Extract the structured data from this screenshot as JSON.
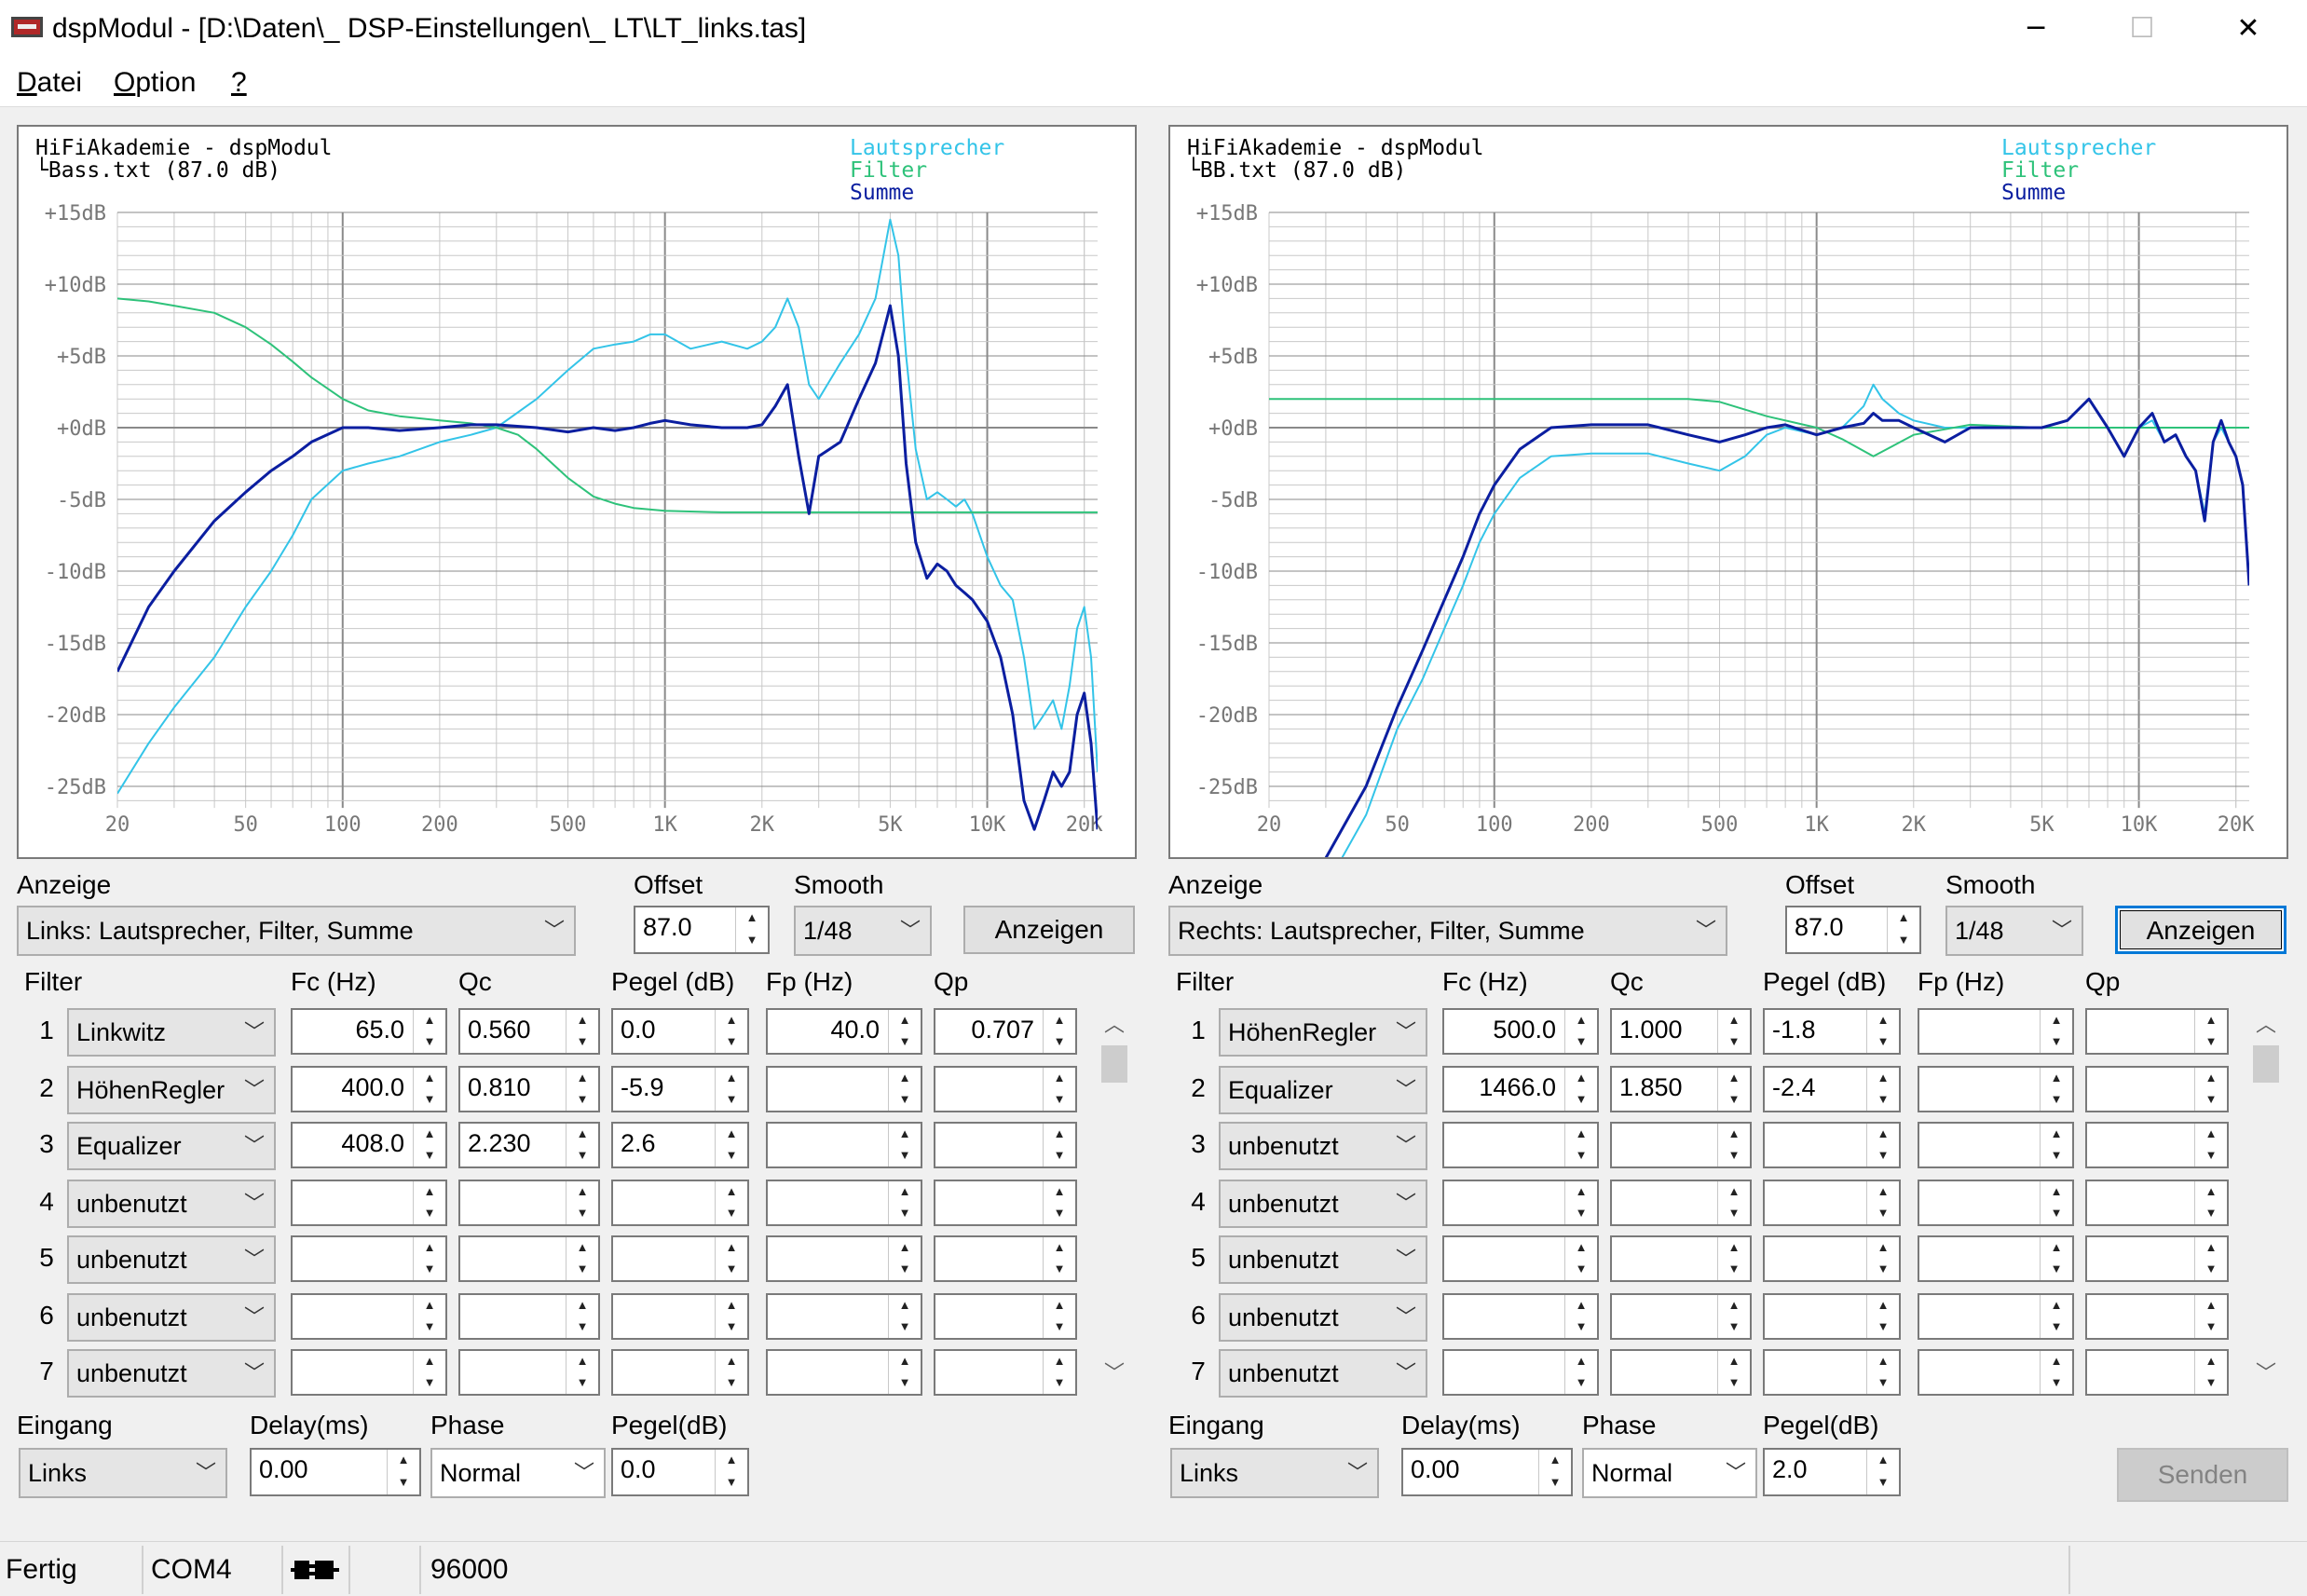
{
  "window": {
    "title": "dspModul - [D:\\Daten\\_ DSP-Einstellungen\\_  LT\\LT_links.tas]",
    "minimize": "─",
    "maximize": "☐",
    "close": "✕"
  },
  "menu": [
    {
      "accel": "D",
      "rest": "atei"
    },
    {
      "accel": "O",
      "rest": "ption"
    },
    {
      "accel": "?",
      "rest": ""
    }
  ],
  "colors": {
    "lautsprecher": "#33c4e8",
    "filter": "#2ec27a",
    "summe": "#0b1ea0",
    "grid": "#c8c8c8",
    "grid_major": "#8a8a8a"
  },
  "panels": [
    {
      "plot": {
        "header1": "HiFiAkademie - dspModul",
        "header2": "└Bass.txt  (87.0 dB)",
        "legend": [
          "Lautsprecher",
          "Filter",
          "Summe"
        ],
        "chart_data": {
          "type": "line",
          "x_scale": "log",
          "xlim": [
            20,
            22000
          ],
          "ylim": [
            -25,
            15
          ],
          "yticks": [
            "+15dB",
            "+10dB",
            "+5dB",
            "+0dB",
            "-5dB",
            "-10dB",
            "-15dB",
            "-20dB",
            "-25dB"
          ],
          "xticks": [
            "20",
            "50",
            "100",
            "200",
            "500",
            "1K",
            "2K",
            "5K",
            "10K",
            "20K"
          ],
          "series": [
            {
              "name": "Lautsprecher",
              "x": [
                20,
                25,
                30,
                40,
                50,
                60,
                70,
                80,
                100,
                120,
                150,
                200,
                250,
                300,
                400,
                500,
                600,
                700,
                800,
                900,
                1000,
                1200,
                1500,
                1800,
                2000,
                2200,
                2400,
                2600,
                2800,
                3000,
                3500,
                4000,
                4500,
                5000,
                5300,
                5600,
                6000,
                6500,
                7000,
                7500,
                8000,
                8500,
                9000,
                10000,
                11000,
                12000,
                13000,
                14000,
                15000,
                16000,
                17000,
                18000,
                19000,
                20000,
                21000,
                22000
              ],
              "y": [
                -25.5,
                -22,
                -19.5,
                -16,
                -12.5,
                -10,
                -7.5,
                -5,
                -3,
                -2.5,
                -2,
                -1,
                -0.5,
                0,
                2,
                4,
                5.5,
                5.8,
                6,
                6.5,
                6.5,
                5.5,
                6,
                5.5,
                6,
                7,
                9,
                7,
                3,
                2,
                4.5,
                6.5,
                9,
                14.5,
                12,
                5,
                -1.5,
                -5,
                -4.5,
                -5,
                -5.5,
                -5,
                -6,
                -9,
                -11,
                -12,
                -16,
                -21,
                -20,
                -19,
                -21,
                -18,
                -14,
                -12.5,
                -16,
                -24
              ]
            },
            {
              "name": "Filter",
              "x": [
                20,
                25,
                30,
                40,
                50,
                60,
                70,
                80,
                100,
                120,
                150,
                200,
                250,
                300,
                350,
                400,
                500,
                600,
                700,
                800,
                1000,
                1500,
                2000,
                5000,
                10000,
                22000
              ],
              "y": [
                9,
                8.8,
                8.5,
                8,
                7,
                5.8,
                4.6,
                3.5,
                2,
                1.2,
                0.8,
                0.5,
                0.3,
                0,
                -0.5,
                -1.5,
                -3.5,
                -4.8,
                -5.3,
                -5.6,
                -5.8,
                -5.9,
                -5.9,
                -5.9,
                -5.9,
                -5.9
              ]
            },
            {
              "name": "Summe",
              "x": [
                20,
                25,
                30,
                40,
                50,
                60,
                70,
                80,
                100,
                120,
                150,
                200,
                250,
                300,
                400,
                500,
                600,
                700,
                800,
                900,
                1000,
                1200,
                1500,
                1800,
                2000,
                2200,
                2400,
                2600,
                2800,
                3000,
                3500,
                4000,
                4500,
                5000,
                5300,
                5600,
                6000,
                6500,
                7000,
                7500,
                8000,
                8500,
                9000,
                10000,
                11000,
                12000,
                13000,
                14000,
                15000,
                16000,
                17000,
                18000,
                19000,
                20000,
                21000,
                22000
              ],
              "y": [
                -17,
                -12.5,
                -10,
                -6.5,
                -4.5,
                -3,
                -2,
                -1,
                0,
                0,
                -0.2,
                0,
                0.2,
                0.2,
                0,
                -0.3,
                0,
                -0.2,
                0,
                0.3,
                0.5,
                0.2,
                0,
                0,
                0.2,
                1.5,
                3,
                -2,
                -6,
                -2,
                -1,
                2,
                4.5,
                8.5,
                5,
                -2.5,
                -8,
                -10.5,
                -9.5,
                -10,
                -11,
                -11.5,
                -12,
                -13.5,
                -16,
                -20,
                -26,
                -28,
                -26,
                -24,
                -25,
                -24,
                -20,
                -18.5,
                -22,
                -28
              ]
            }
          ]
        }
      },
      "anzeige_label": "Anzeige",
      "anzeige_value": "Links: Lautsprecher, Filter, Summe",
      "offset_label": "Offset",
      "offset_value": "87.0",
      "smooth_label": "Smooth",
      "smooth_value": "1/48",
      "anzeigen_button": "Anzeigen",
      "headers": [
        "Filter",
        "Fc (Hz)",
        "Qc",
        "Pegel (dB)",
        "Fp (Hz)",
        "Qp"
      ],
      "filters": [
        {
          "n": "1",
          "type": "Linkwitz",
          "fc": "65.0",
          "qc": "0.560",
          "pegel": "0.0",
          "fp": "40.0",
          "qp": "0.707"
        },
        {
          "n": "2",
          "type": "HöhenRegler",
          "fc": "400.0",
          "qc": "0.810",
          "pegel": "-5.9",
          "fp": "",
          "qp": ""
        },
        {
          "n": "3",
          "type": "Equalizer",
          "fc": "408.0",
          "qc": "2.230",
          "pegel": "2.6",
          "fp": "",
          "qp": ""
        },
        {
          "n": "4",
          "type": "unbenutzt",
          "fc": "",
          "qc": "",
          "pegel": "",
          "fp": "",
          "qp": ""
        },
        {
          "n": "5",
          "type": "unbenutzt",
          "fc": "",
          "qc": "",
          "pegel": "",
          "fp": "",
          "qp": ""
        },
        {
          "n": "6",
          "type": "unbenutzt",
          "fc": "",
          "qc": "",
          "pegel": "",
          "fp": "",
          "qp": ""
        },
        {
          "n": "7",
          "type": "unbenutzt",
          "fc": "",
          "qc": "",
          "pegel": "",
          "fp": "",
          "qp": ""
        }
      ],
      "eingang_label": "Eingang",
      "eingang_value": "Links",
      "delay_label": "Delay(ms)",
      "delay_value": "0.00",
      "phase_label": "Phase",
      "phase_value": "Normal",
      "pegel_label": "Pegel(dB)",
      "pegel_value": "0.0"
    },
    {
      "plot": {
        "header1": "HiFiAkademie - dspModul",
        "header2": "└BB.txt  (87.0 dB)",
        "legend": [
          "Lautsprecher",
          "Filter",
          "Summe"
        ],
        "chart_data": {
          "type": "line",
          "x_scale": "log",
          "xlim": [
            20,
            22000
          ],
          "ylim": [
            -25,
            15
          ],
          "yticks": [
            "+15dB",
            "+10dB",
            "+5dB",
            "+0dB",
            "-5dB",
            "-10dB",
            "-15dB",
            "-20dB",
            "-25dB"
          ],
          "xticks": [
            "20",
            "50",
            "100",
            "200",
            "500",
            "1K",
            "2K",
            "5K",
            "10K",
            "20K"
          ],
          "series": [
            {
              "name": "Lautsprecher",
              "x": [
                20,
                30,
                40,
                50,
                60,
                70,
                80,
                90,
                100,
                120,
                150,
                200,
                300,
                400,
                500,
                600,
                700,
                800,
                1000,
                1200,
                1400,
                1500,
                1600,
                1800,
                2000,
                2500,
                3000,
                4000,
                5000,
                6000,
                7000,
                8000,
                9000,
                10000,
                11000,
                12000,
                13000,
                14000,
                15000,
                16000,
                17000,
                18000,
                19000,
                20000,
                21000,
                22000
              ],
              "y": [
                -38,
                -32,
                -27,
                -21,
                -17.5,
                -14,
                -11,
                -8,
                -6,
                -3.5,
                -2,
                -1.8,
                -1.8,
                -2.5,
                -3,
                -2,
                -0.5,
                0,
                -0.5,
                0,
                1.5,
                3,
                2,
                1,
                0.5,
                0,
                0,
                0,
                0,
                0.5,
                2,
                0,
                -2,
                0,
                0.5,
                -1,
                -0.5,
                -2,
                -3,
                -6,
                -1,
                0,
                -1,
                -2,
                -4,
                -11
              ]
            },
            {
              "name": "Filter",
              "x": [
                20,
                100,
                200,
                300,
                400,
                500,
                700,
                1000,
                1200,
                1500,
                2000,
                3000,
                5000,
                22000
              ],
              "y": [
                2,
                2,
                2,
                2,
                2,
                1.8,
                0.8,
                0,
                -0.8,
                -2,
                -0.5,
                0.2,
                0,
                0
              ]
            },
            {
              "name": "Summe",
              "x": [
                20,
                30,
                40,
                50,
                60,
                70,
                80,
                90,
                100,
                120,
                150,
                200,
                300,
                400,
                500,
                600,
                700,
                800,
                1000,
                1200,
                1400,
                1500,
                1600,
                1800,
                2000,
                2500,
                3000,
                4000,
                5000,
                6000,
                7000,
                8000,
                9000,
                10000,
                11000,
                12000,
                13000,
                14000,
                15000,
                16000,
                17000,
                18000,
                19000,
                20000,
                21000,
                22000
              ],
              "y": [
                -37,
                -30,
                -25,
                -19.5,
                -15.5,
                -12,
                -9,
                -6,
                -4,
                -1.5,
                0,
                0.2,
                0.2,
                -0.5,
                -1,
                -0.5,
                0,
                0.2,
                -0.5,
                0,
                0.3,
                1,
                0.5,
                0.5,
                0,
                -1,
                0,
                0,
                0,
                0.5,
                2,
                0,
                -2,
                0,
                1,
                -1,
                -0.5,
                -2,
                -3,
                -6.5,
                -1,
                0.5,
                -1,
                -2,
                -4,
                -11
              ]
            }
          ]
        }
      },
      "anzeige_label": "Anzeige",
      "anzeige_value": "Rechts: Lautsprecher, Filter, Summe",
      "offset_label": "Offset",
      "offset_value": "87.0",
      "smooth_label": "Smooth",
      "smooth_value": "1/48",
      "anzeigen_button": "Anzeigen",
      "headers": [
        "Filter",
        "Fc (Hz)",
        "Qc",
        "Pegel (dB)",
        "Fp (Hz)",
        "Qp"
      ],
      "filters": [
        {
          "n": "1",
          "type": "HöhenRegler",
          "fc": "500.0",
          "qc": "1.000",
          "pegel": "-1.8",
          "fp": "",
          "qp": ""
        },
        {
          "n": "2",
          "type": "Equalizer",
          "fc": "1466.0",
          "qc": "1.850",
          "pegel": "-2.4",
          "fp": "",
          "qp": ""
        },
        {
          "n": "3",
          "type": "unbenutzt",
          "fc": "",
          "qc": "",
          "pegel": "",
          "fp": "",
          "qp": ""
        },
        {
          "n": "4",
          "type": "unbenutzt",
          "fc": "",
          "qc": "",
          "pegel": "",
          "fp": "",
          "qp": ""
        },
        {
          "n": "5",
          "type": "unbenutzt",
          "fc": "",
          "qc": "",
          "pegel": "",
          "fp": "",
          "qp": ""
        },
        {
          "n": "6",
          "type": "unbenutzt",
          "fc": "",
          "qc": "",
          "pegel": "",
          "fp": "",
          "qp": ""
        },
        {
          "n": "7",
          "type": "unbenutzt",
          "fc": "",
          "qc": "",
          "pegel": "",
          "fp": "",
          "qp": ""
        }
      ],
      "eingang_label": "Eingang",
      "eingang_value": "Links",
      "delay_label": "Delay(ms)",
      "delay_value": "0.00",
      "phase_label": "Phase",
      "phase_value": "Normal",
      "pegel_label": "Pegel(dB)",
      "pegel_value": "2.0"
    }
  ],
  "senden_button": "Senden",
  "status": {
    "state": "Fertig",
    "port": "COM4",
    "rate": "96000"
  }
}
